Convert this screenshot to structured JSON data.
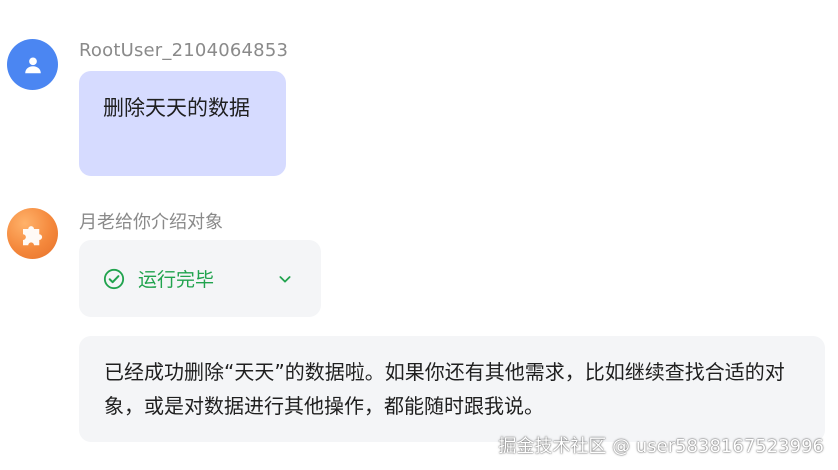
{
  "colors": {
    "user_avatar_bg": "#4b86f2",
    "bot_avatar_bg": "#f4883c",
    "user_bubble_bg": "#d6dbff",
    "bot_bubble_bg": "#f4f5f7",
    "status_green": "#21a34e"
  },
  "messages": [
    {
      "role": "user",
      "avatar_icon": "user-icon",
      "sender": "RootUser_2104064853",
      "text": "删除天天的数据"
    },
    {
      "role": "bot",
      "avatar_icon": "puzzle-icon",
      "sender": "月老给你介绍对象",
      "tool_status": {
        "icon": "check-circle-icon",
        "label": "运行完毕",
        "toggle_icon": "chevron-down-icon"
      },
      "text": "已经成功删除“天天”的数据啦。如果你还有其他需求，比如继续查找合适的对象，或是对数据进行其他操作，都能随时跟我说。"
    }
  ],
  "watermark": "掘金技术社区 @ user5838167523996"
}
